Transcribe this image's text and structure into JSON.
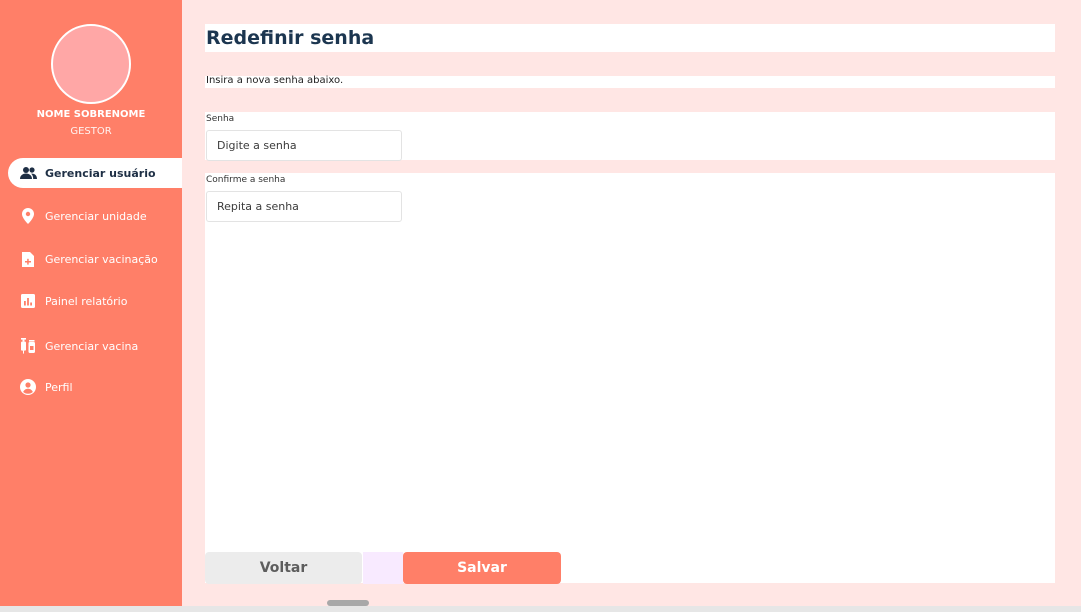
{
  "sidebar": {
    "user_name": "NOME SOBRENOME",
    "user_role": "GESTOR",
    "items": [
      {
        "label": "Gerenciar usuário",
        "icon": "users-icon",
        "active": true
      },
      {
        "label": "Gerenciar unidade",
        "icon": "location-pin-icon",
        "active": false
      },
      {
        "label": "Gerenciar vacinação",
        "icon": "document-icon",
        "active": false
      },
      {
        "label": "Painel relatório",
        "icon": "bar-chart-icon",
        "active": false
      },
      {
        "label": "Gerenciar vacina",
        "icon": "vaccine-icon",
        "active": false
      },
      {
        "label": "Perfil",
        "icon": "profile-icon",
        "active": false
      }
    ]
  },
  "main": {
    "title": "Redefinir senha",
    "subtitle": "Insira a nova senha abaixo.",
    "password_label": "Senha",
    "password_placeholder": "Digite a senha",
    "confirm_label": "Confirme a senha",
    "confirm_placeholder": "Repita a senha"
  },
  "buttons": {
    "back": "Voltar",
    "save": "Salvar"
  },
  "colors": {
    "accent": "#ff7f68",
    "background": "#ffe6e4",
    "title": "#1c3650"
  }
}
